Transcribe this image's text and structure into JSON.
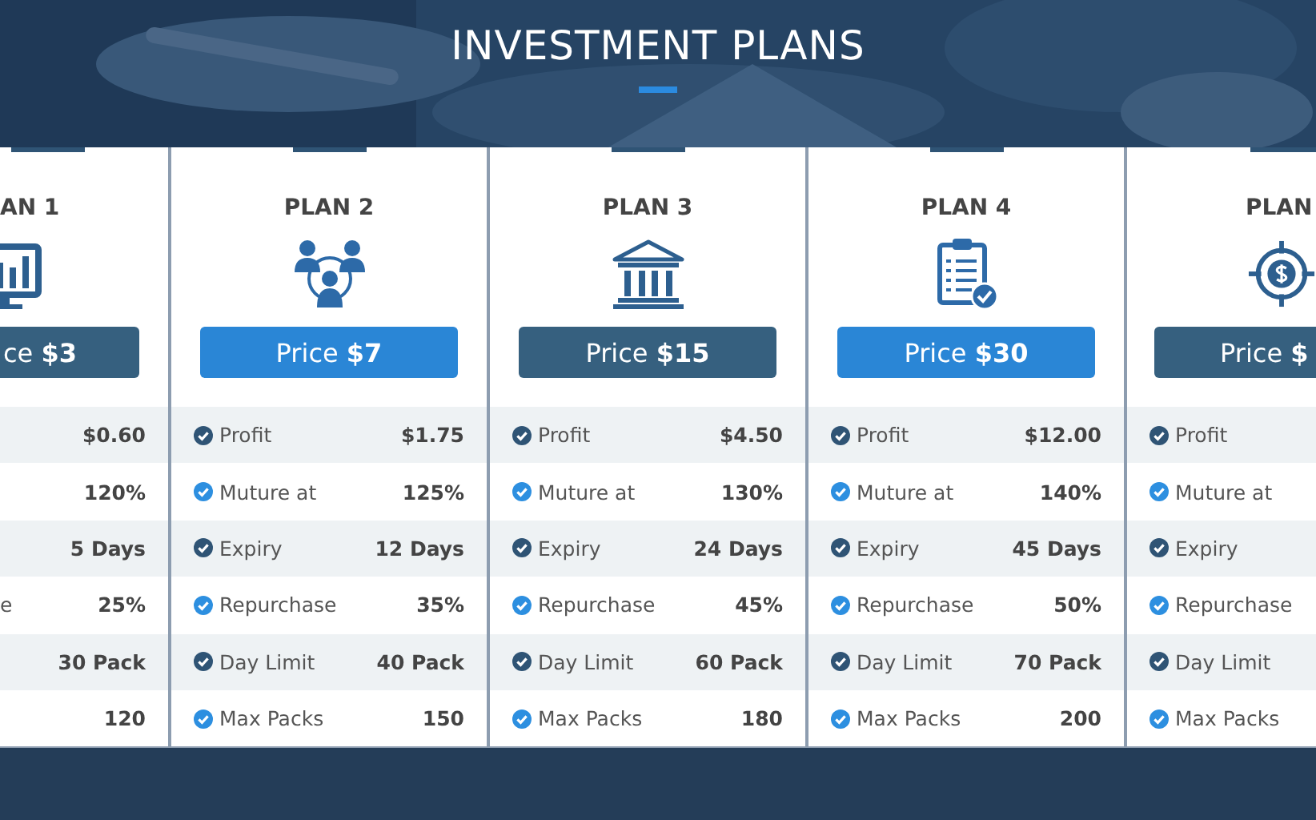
{
  "section": {
    "title": "INVESTMENT PLANS"
  },
  "plans": [
    {
      "title": "AN 1",
      "price": "ce **$3**",
      "featured": false,
      "features": [
        {
          "value": "$0.60"
        },
        {
          "value": "120%"
        },
        {
          "value": "5 Days"
        },
        {
          "label": "e",
          "value": "25%"
        },
        {
          "value": "30 Pack"
        },
        {
          "value": "120"
        }
      ]
    },
    {
      "title": "PLAN 2",
      "price": "Price **$7**",
      "featured": true,
      "features": [
        {
          "label": "Profit",
          "value": "$1.75"
        },
        {
          "label": "Muture at",
          "value": "125%"
        },
        {
          "label": "Expiry",
          "value": "12 Days"
        },
        {
          "label": "Repurchase",
          "value": "35%"
        },
        {
          "label": "Day Limit",
          "value": "40 Pack"
        },
        {
          "label": "Max Packs",
          "value": "150"
        }
      ]
    },
    {
      "title": "PLAN 3",
      "price": "Price **$15**",
      "featured": false,
      "features": [
        {
          "label": "Profit",
          "value": "$4.50"
        },
        {
          "label": "Muture at",
          "value": "130%"
        },
        {
          "label": "Expiry",
          "value": "24 Days"
        },
        {
          "label": "Repurchase",
          "value": "45%"
        },
        {
          "label": "Day Limit",
          "value": "60 Pack"
        },
        {
          "label": "Max Packs",
          "value": "180"
        }
      ]
    },
    {
      "title": "PLAN 4",
      "price": "Price **$30**",
      "featured": true,
      "features": [
        {
          "label": "Profit",
          "value": "$12.00"
        },
        {
          "label": "Muture at",
          "value": "140%"
        },
        {
          "label": "Expiry",
          "value": "45 Days"
        },
        {
          "label": "Repurchase",
          "value": "50%"
        },
        {
          "label": "Day Limit",
          "value": "70 Pack"
        },
        {
          "label": "Max Packs",
          "value": "200"
        }
      ]
    },
    {
      "title": "PLAN",
      "price": "Price **$**",
      "featured": false,
      "features": [
        {
          "label": "Profit"
        },
        {
          "label": "Muture at"
        },
        {
          "label": "Expiry"
        },
        {
          "label": "Repurchase"
        },
        {
          "label": "Day Limit"
        },
        {
          "label": "Max Packs"
        }
      ]
    }
  ]
}
